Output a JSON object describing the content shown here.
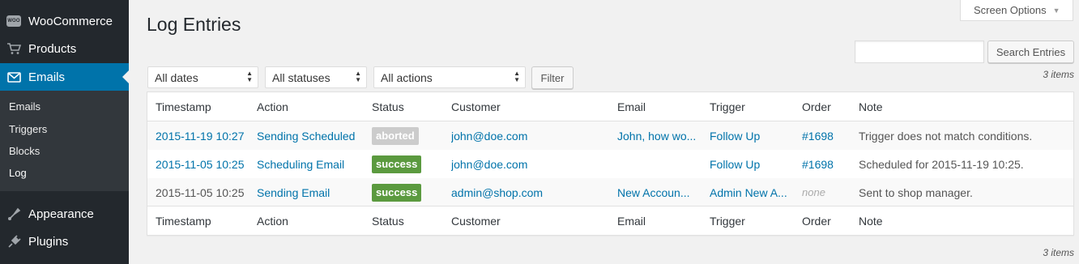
{
  "sidebar": {
    "items": [
      {
        "label": "WooCommerce",
        "icon": "woo-icon"
      },
      {
        "label": "Products",
        "icon": "cart-icon"
      },
      {
        "label": "Emails",
        "icon": "envelope-icon",
        "active": true
      },
      {
        "label": "Appearance",
        "icon": "brush-icon"
      },
      {
        "label": "Plugins",
        "icon": "plugin-icon"
      }
    ],
    "submenu": [
      "Emails",
      "Triggers",
      "Blocks",
      "Log"
    ],
    "woo_badge": "WOO"
  },
  "header": {
    "title": "Log Entries",
    "screen_options": "Screen Options"
  },
  "search": {
    "button": "Search Entries",
    "value": ""
  },
  "filters": {
    "dates": "All dates",
    "statuses": "All statuses",
    "actions": "All actions",
    "button": "Filter"
  },
  "items_count": "3 items",
  "table": {
    "columns": [
      "Timestamp",
      "Action",
      "Status",
      "Customer",
      "Email",
      "Trigger",
      "Order",
      "Note"
    ],
    "rows": [
      {
        "timestamp": "2015-11-19 10:27",
        "action": "Sending Scheduled",
        "status": "aborted",
        "status_color": "#cccccc",
        "customer": "john@doe.com",
        "email": "John, how wo...",
        "trigger": "Follow Up",
        "order": "#1698",
        "note": "Trigger does not match conditions."
      },
      {
        "timestamp": "2015-11-05 10:25",
        "action": "Scheduling Email",
        "status": "success",
        "status_color": "#5b9a3f",
        "customer": "john@doe.com",
        "email": "",
        "trigger": "Follow Up",
        "order": "#1698",
        "note": "Scheduled for 2015-11-19 10:25."
      },
      {
        "timestamp": "2015-11-05 10:25",
        "action": "Sending Email",
        "status": "success",
        "status_color": "#5b9a3f",
        "customer": "admin@shop.com",
        "email": "New Accoun...",
        "trigger": "Admin New A...",
        "order": "none",
        "note": "Sent to shop manager."
      }
    ]
  },
  "colors": {
    "accent": "#0073aa",
    "sidebar": "#23282d",
    "success": "#5b9a3f",
    "aborted": "#cccccc"
  }
}
